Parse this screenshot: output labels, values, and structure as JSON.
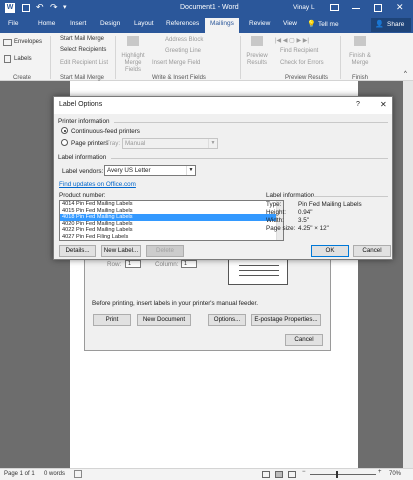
{
  "titlebar": {
    "document_title": "Document1 - Word",
    "user": "Vinay L"
  },
  "tabs": [
    "File",
    "Home",
    "Insert",
    "Design",
    "Layout",
    "References",
    "Mailings",
    "Review",
    "View"
  ],
  "tell_me": "Tell me",
  "share": "Share",
  "ribbon": {
    "create": {
      "envelopes": "Envelopes",
      "labels": "Labels",
      "group": "Create"
    },
    "start_mail_merge": {
      "start": "Start Mail Merge",
      "select": "Select Recipients",
      "edit": "Edit Recipient List",
      "group": "Start Mail Merge"
    },
    "write_insert": {
      "highlight": "Highlight Merge Fields",
      "address": "Address Block",
      "greeting": "Greeting Line",
      "insert": "Insert Merge Field",
      "group": "Write & Insert Fields"
    },
    "preview": {
      "preview": "Preview Results",
      "find": "Find Recipient",
      "check": "Check for Errors",
      "group": "Preview Results"
    },
    "finish": {
      "finish": "Finish & Merge",
      "group": "Finish"
    }
  },
  "envelopes_dialog": {
    "row_label": "Row:",
    "row_value": "1",
    "column_label": "Column:",
    "column_value": "1",
    "note": "Before printing, insert labels in your printer's manual feeder.",
    "buttons": {
      "print": "Print",
      "new_document": "New Document",
      "options": "Options...",
      "epostage": "E-postage Properties...",
      "cancel": "Cancel"
    }
  },
  "dialog": {
    "title": "Label Options",
    "help": "?",
    "close": "✕",
    "printer_information": "Printer information",
    "continuous": "Continuous-feed printers",
    "page_printers": "Page printers",
    "tray_label": "Tray:",
    "tray_value": "Manual",
    "label_information": "Label information",
    "vendors_label": "Label vendors:",
    "vendors_value": "Avery US Letter",
    "updates_link": "Find updates on Office.com",
    "product_number": "Product number:",
    "products": [
      "4014 Pin Fed Mailing Labels",
      "4015 Pin Fed Mailing Labels",
      "4018 Pin Fed Mailing Labels",
      "4020 Pin Fed Mailing Labels",
      "4022 Pin Fed Mailing Labels",
      "4027 Pin Fed Filing Labels"
    ],
    "selected_product": "4018 Pin Fed Mailing Labels",
    "info_heading": "Label information",
    "info": [
      {
        "key": "Type:",
        "value": "Pin Fed Mailing Labels"
      },
      {
        "key": "Height:",
        "value": "0.94\""
      },
      {
        "key": "Width:",
        "value": "3.5\""
      },
      {
        "key": "Page size:",
        "value": "4.25\" × 12\""
      }
    ],
    "buttons": {
      "details": "Details...",
      "new_label": "New Label...",
      "delete": "Delete",
      "ok": "OK",
      "cancel": "Cancel"
    }
  },
  "status": {
    "page": "Page 1 of 1",
    "words": "0 words",
    "zoom": "70%"
  },
  "colors": {
    "word_blue": "#2b579a",
    "selection": "#3399ff",
    "link": "#0066cc"
  }
}
